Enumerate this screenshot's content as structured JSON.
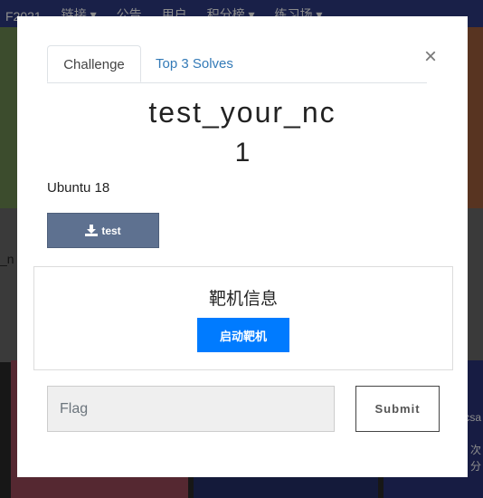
{
  "background": {
    "nav_items": [
      "F2021",
      "链接 ▾",
      "公告",
      "用户",
      "积分榜 ▾",
      "练习场 ▾"
    ],
    "partial_text": "_n",
    "right_card_texts": [
      "csa",
      "次",
      "分"
    ]
  },
  "modal": {
    "close_label": "×",
    "tabs": [
      {
        "label": "Challenge"
      },
      {
        "label": "Top 3 Solves"
      }
    ],
    "challenge_name": "test_your_nc",
    "challenge_value": "1",
    "description": "Ubuntu 18",
    "file_button_label": "test",
    "target_section_title": "靶机信息",
    "start_target_label": "启动靶机",
    "flag_input": {
      "placeholder": "Flag",
      "value": ""
    },
    "submit_label": "Submit"
  },
  "colors": {
    "accent": "#007bff",
    "file_button": "#5e7190",
    "tab_link": "#337ab7"
  }
}
